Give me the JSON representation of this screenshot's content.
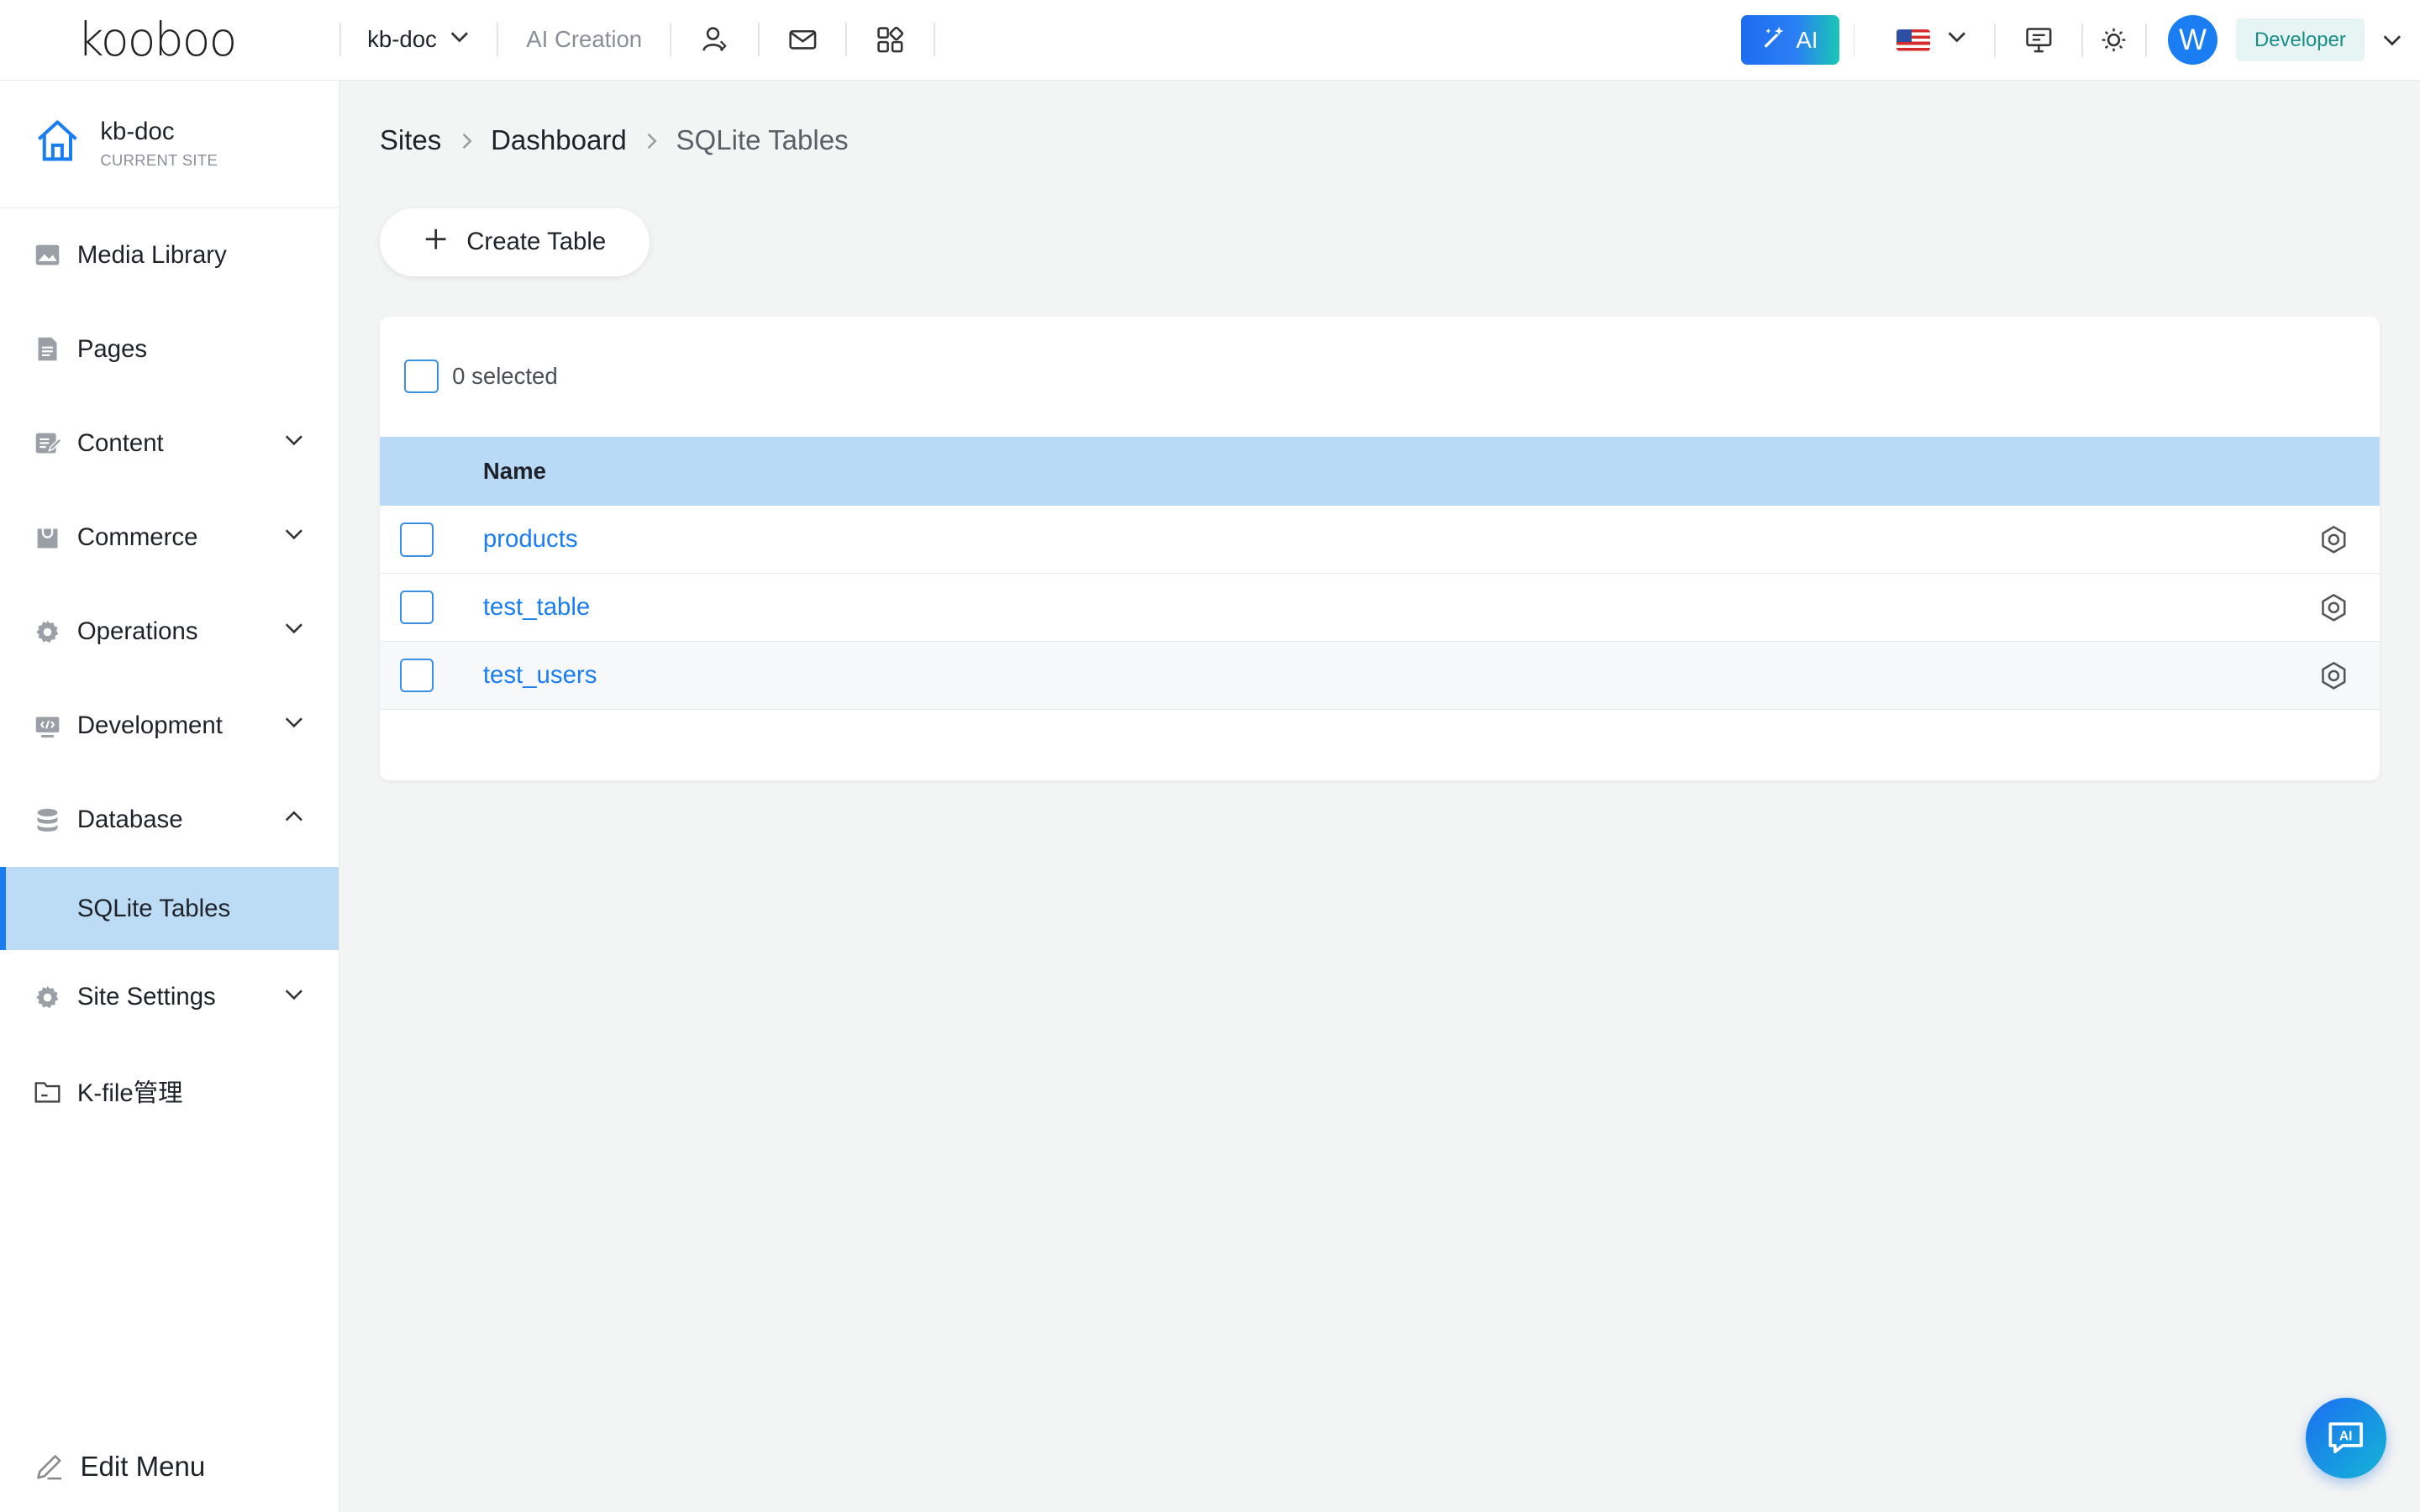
{
  "topbar": {
    "logo": "kooboo",
    "site_name": "kb-doc",
    "ai_creation": "AI Creation",
    "ai_button": "AI",
    "role": "Developer",
    "avatar_letter": "W"
  },
  "sidebar": {
    "current_site": {
      "name": "kb-doc",
      "label": "CURRENT SITE"
    },
    "items": [
      {
        "label": "Media Library",
        "icon": "image-icon"
      },
      {
        "label": "Pages",
        "icon": "page-icon"
      },
      {
        "label": "Content",
        "icon": "content-icon",
        "expandable": true
      },
      {
        "label": "Commerce",
        "icon": "commerce-icon",
        "expandable": true
      },
      {
        "label": "Operations",
        "icon": "gear-icon",
        "expandable": true
      },
      {
        "label": "Development",
        "icon": "code-icon",
        "expandable": true
      },
      {
        "label": "Database",
        "icon": "database-icon",
        "expandable": true,
        "expanded": true
      },
      {
        "label": "Site Settings",
        "icon": "gear-icon",
        "expandable": true
      },
      {
        "label": "K-file管理",
        "icon": "folder-icon"
      }
    ],
    "sub_active": "SQLite Tables",
    "edit_menu": "Edit Menu"
  },
  "breadcrumb": {
    "sites": "Sites",
    "dashboard": "Dashboard",
    "current": "SQLite Tables"
  },
  "create_button": "Create Table",
  "table": {
    "selected_text": "0 selected",
    "column_name": "Name",
    "rows": [
      {
        "name": "products"
      },
      {
        "name": "test_table"
      },
      {
        "name": "test_users"
      }
    ]
  },
  "fab_label": "AI",
  "colors": {
    "accent": "#1a7ef2",
    "header_row": "#b9daf7",
    "active_nav": "#bcdcf5",
    "role_badge": "#e6f4f3"
  }
}
